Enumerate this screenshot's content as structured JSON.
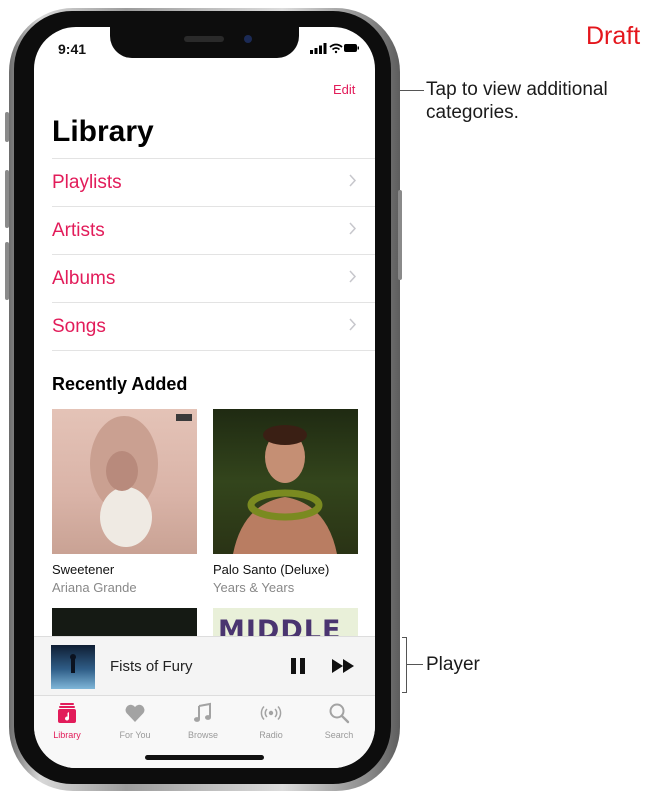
{
  "watermark": "Draft",
  "callouts": {
    "edit_line1": "Tap to view additional",
    "edit_line2": "categories.",
    "player": "Player"
  },
  "status_bar": {
    "time": "9:41"
  },
  "library": {
    "edit_label": "Edit",
    "title": "Library",
    "categories": [
      {
        "label": "Playlists"
      },
      {
        "label": "Artists"
      },
      {
        "label": "Albums"
      },
      {
        "label": "Songs"
      }
    ]
  },
  "recently_added": {
    "title": "Recently Added",
    "albums": [
      {
        "name": "Sweetener",
        "artist": "Ariana Grande"
      },
      {
        "name": "Palo Santo (Deluxe)",
        "artist": "Years & Years"
      }
    ],
    "partial_art_text": "MIDDLE"
  },
  "player": {
    "song_title": "Fists of Fury",
    "pause_icon": "pause-icon",
    "next_icon": "fast-forward-icon"
  },
  "tab_bar": {
    "active_color": "#e21c5a",
    "tabs": [
      {
        "label": "Library",
        "icon": "library-icon",
        "active": true
      },
      {
        "label": "For You",
        "icon": "heart-icon",
        "active": false
      },
      {
        "label": "Browse",
        "icon": "music-note-icon",
        "active": false
      },
      {
        "label": "Radio",
        "icon": "radio-icon",
        "active": false
      },
      {
        "label": "Search",
        "icon": "search-icon",
        "active": false
      }
    ]
  },
  "colors": {
    "accent": "#e21c5a",
    "watermark": "#e4161c"
  }
}
